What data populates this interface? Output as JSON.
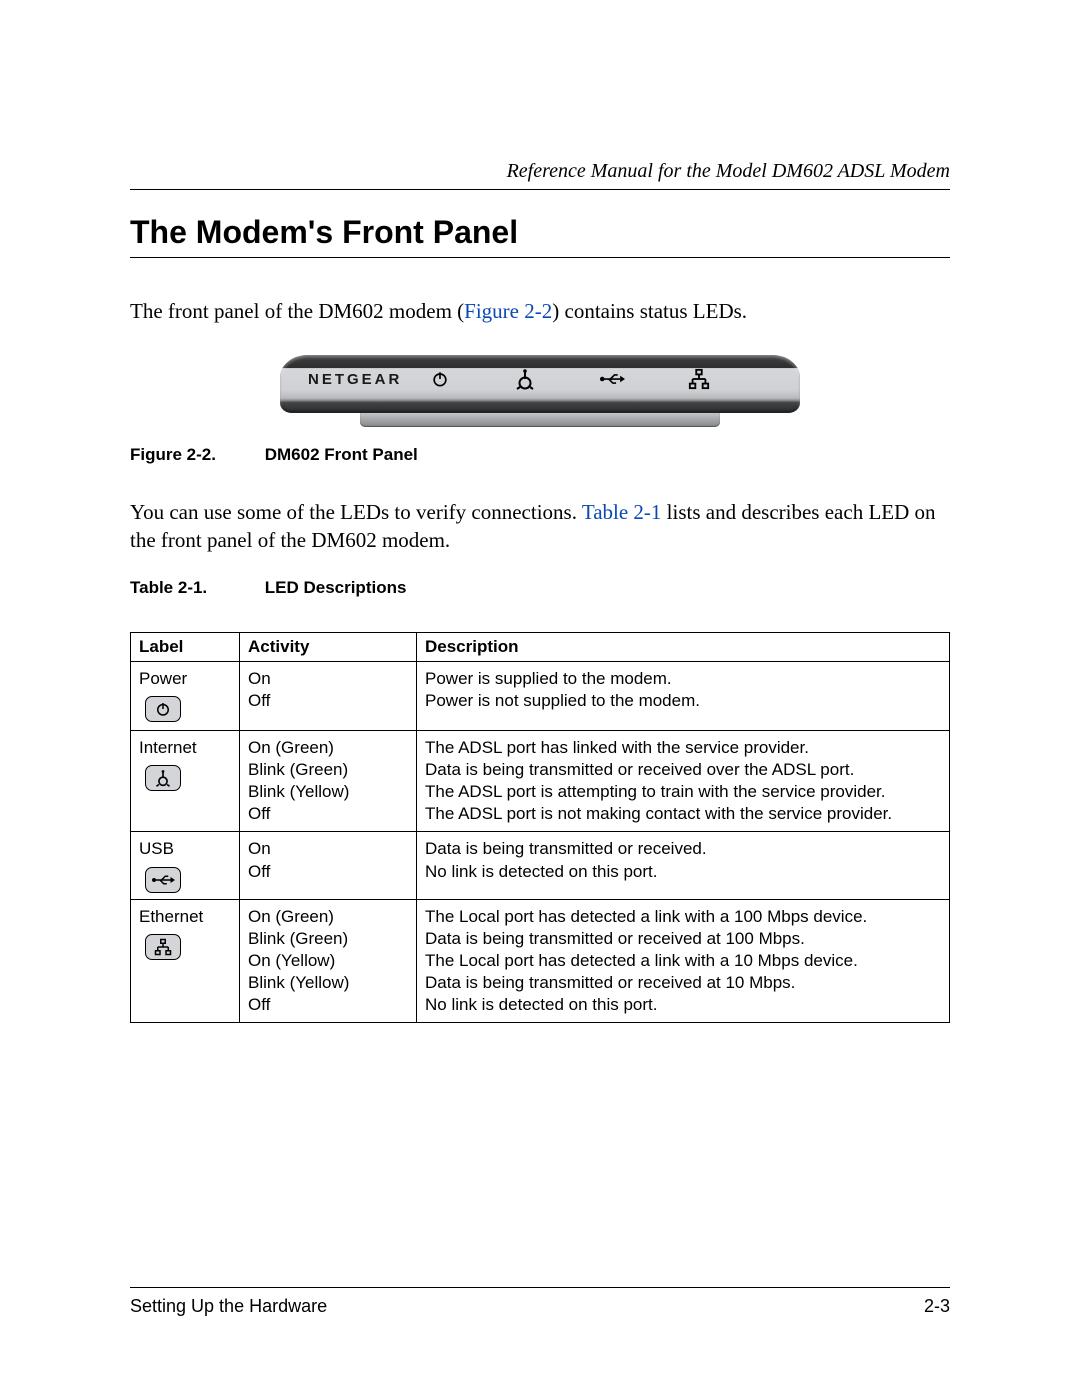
{
  "header": {
    "doc_title": "Reference Manual for the Model DM602 ADSL Modem"
  },
  "section": {
    "title": "The Modem's Front Panel"
  },
  "body": {
    "para1_a": "The front panel of the DM602 modem (",
    "para1_link": "Figure 2-2",
    "para1_b": ") contains status LEDs.",
    "para2_a": "You can use some of the LEDs to verify connections. ",
    "para2_link": "Table 2-1",
    "para2_b": " lists and describes each LED on the front panel of the DM602 modem."
  },
  "figure": {
    "label": "Figure 2-2.",
    "title": "DM602 Front Panel",
    "brand": "NETGEAR"
  },
  "table": {
    "label": "Table 2-1.",
    "title": "LED Descriptions",
    "headers": [
      "Label",
      "Activity",
      "Description"
    ],
    "rows": [
      {
        "label": "Power",
        "icon": "power-icon",
        "activity": [
          "On",
          "Off"
        ],
        "description": [
          "Power is supplied to the modem.",
          "Power is not supplied to the modem."
        ]
      },
      {
        "label": "Internet",
        "icon": "internet-icon",
        "activity": [
          "On (Green)",
          "Blink (Green)",
          "Blink (Yellow)",
          "Off"
        ],
        "description": [
          "The ADSL port has linked with the service provider.",
          "Data is being transmitted or received over the ADSL port.",
          "The ADSL port is attempting to train with the service provider.",
          "The ADSL port is not making contact with the service provider."
        ]
      },
      {
        "label": "USB",
        "icon": "usb-icon",
        "activity": [
          "On",
          "Off"
        ],
        "description": [
          "Data is being transmitted or received.",
          "No link is detected on this port."
        ]
      },
      {
        "label": "Ethernet",
        "icon": "ethernet-icon",
        "activity": [
          "On (Green)",
          "Blink (Green)",
          "On (Yellow)",
          "Blink (Yellow)",
          "Off"
        ],
        "description": [
          "The Local port has detected a link with a 100 Mbps device.",
          "Data is being transmitted or received at 100 Mbps.",
          "The Local port has detected a link with a 10 Mbps device.",
          "Data is being transmitted or received at 10 Mbps.",
          "No link is detected on this port."
        ]
      }
    ]
  },
  "footer": {
    "left": "Setting Up the Hardware",
    "right": "2-3"
  }
}
